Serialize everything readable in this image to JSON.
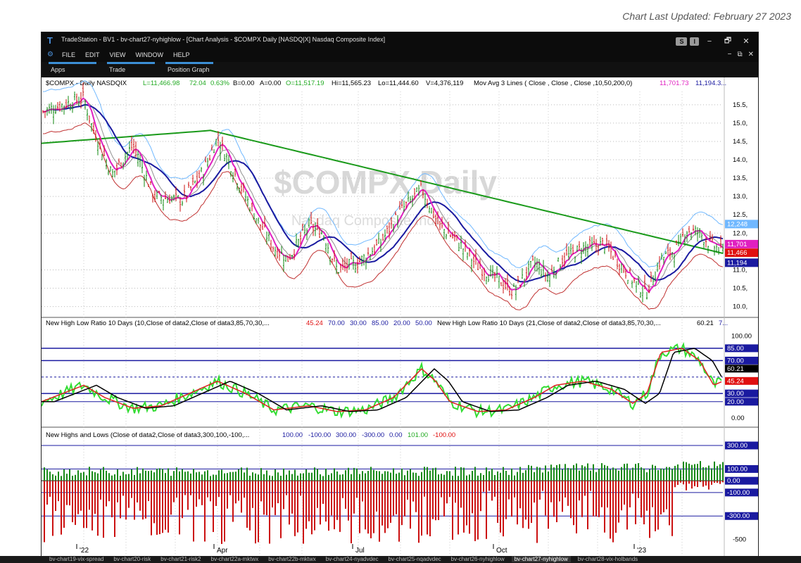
{
  "updated": "Chart Last Updated: February 27 2023",
  "window": {
    "title": "TradeStation - BV1 - bv-chart27-nyhighlow - [Chart Analysis - $COMPX Daily [NASDQ|X] Nasdaq Composite Index]",
    "ctrl_s": "S",
    "ctrl_i": "I",
    "min": "−",
    "restore": "🗗",
    "close": "✕"
  },
  "menu": {
    "file": "FILE",
    "edit": "EDIT",
    "view": "VIEW",
    "window": "WINDOW",
    "help": "HELP"
  },
  "quickbar": {
    "apps": "Apps",
    "trade": "Trade",
    "position_graph": "Position Graph"
  },
  "colors": {
    "red": "#e01010",
    "green": "#22aa22",
    "blue": "#1a1aa0",
    "magenta": "#e020c0",
    "lightblue": "#70b8ff",
    "gray": "#909090",
    "brown": "#c03030"
  },
  "panel1": {
    "symbol": "$COMPX - Daily  NASDQIX",
    "last": "L=11,466.98",
    "chg": "72.04",
    "pct": "0.63%",
    "b": "B=0.00",
    "a": "A=0.00",
    "o": "O=11,517.19",
    "hi": "Hi=11,565.23",
    "lo": "Lo=11,444.60",
    "v": "V=4,376,119",
    "ma": "Mov Avg 3 Lines ( Close , Close , Close ,10,50,200,0)",
    "ma1": "11,701.73",
    "ma2": "11,194.3...",
    "watermark": "$COMPX Daily",
    "watermark2": "Nasdaq Composite Index",
    "ticks": [
      "15.5",
      "15.0",
      "14.5",
      "14.0",
      "13.5",
      "13.0",
      "12.5",
      "12.0",
      "11.0",
      "10.5",
      "10.0"
    ],
    "flags": [
      "12,248",
      "11,701",
      "11,466",
      "11,194"
    ]
  },
  "panel2": {
    "title1": "New High Low Ratio 10 Days (10,Close of data2,Close of data3,85,70,30,...",
    "v1": "45.24",
    "v2": "70.00",
    "v3": "30.00",
    "v4": "85.00",
    "v5": "20.00",
    "v6": "50.00",
    "title2": "New High Low Ratio 10 Days (21,Close of data2,Close of data3,85,70,30,...",
    "v7": "60.21",
    "v8": "7...",
    "ticks": [
      "100.00",
      "0.00"
    ],
    "flags": [
      "85.00",
      "70.00",
      "60.21",
      "45.24",
      "30.00",
      "20.00"
    ]
  },
  "panel3": {
    "title": "New Highs and Lows (Close of data2,Close of data3,300,100,-100,...",
    "v1": "100.00",
    "v2": "-100.00",
    "v3": "300.00",
    "v4": "-300.00",
    "v5": "0.00",
    "v6": "101.00",
    "v7": "-100.00",
    "ticks": [
      "-500"
    ],
    "flags": [
      "300.00",
      "100.00",
      "0.00",
      "-100.00",
      "-300.00"
    ]
  },
  "xaxis": [
    "'22",
    "Apr",
    "Jul",
    "Oct",
    "'23"
  ],
  "tabs": [
    "bv-chart19-vix-spread",
    "bv-chart20-risk",
    "bv-chart21-risk2",
    "bv-chart22a-mktwx",
    "bv-chart22b-mktwx",
    "bv-chart24-nyadvdec",
    "bv-chart25-nqadvdec",
    "bv-chart26-nyhighlow",
    "bv-chart27-nyhighlow",
    "bv-chart28-vix-holbands"
  ],
  "chart_data": {
    "type": "line",
    "panels": [
      {
        "name": "$COMPX Daily",
        "x": [
          "'22",
          "Apr",
          "Jul",
          "Oct",
          "'23"
        ],
        "ylim": [
          9.8,
          15.9
        ],
        "series": [
          {
            "name": "$COMPX",
            "values": [
              15.6,
              13.5,
              14.8,
              11.2,
              12.0,
              13.2,
              10.9,
              11.3,
              10.6,
              12.1,
              11.47
            ]
          },
          {
            "name": "Mov Avg 200",
            "values": [
              14.5,
              14.8,
              14.8,
              14.4,
              14.0,
              13.5,
              12.8,
              12.4,
              12.0,
              11.7,
              11.47
            ]
          },
          {
            "name": "Mov Avg 50",
            "values": [
              15.3,
              14.5,
              13.9,
              13.0,
              11.5,
              11.8,
              12.0,
              11.1,
              11.0,
              11.0,
              11.19
            ]
          },
          {
            "name": "Mov Avg 10",
            "values": [
              15.4,
              13.7,
              14.5,
              11.4,
              12.0,
              13.0,
              11.0,
              11.1,
              10.5,
              11.5,
              11.7
            ]
          }
        ]
      },
      {
        "name": "New High Low Ratio 10 Days",
        "ylim": [
          0,
          100
        ],
        "series": [
          {
            "name": "10",
            "values": [
              30,
              45,
              20,
              40,
              15,
              65,
              20,
              45,
              20,
              90,
              45.24
            ]
          },
          {
            "name": "21",
            "values": [
              35,
              40,
              25,
              35,
              18,
              55,
              25,
              38,
              25,
              80,
              60.21
            ]
          }
        ]
      },
      {
        "name": "New Highs and Lows",
        "ylim": [
          -500,
          300
        ],
        "series": [
          {
            "name": "New Highs",
            "values": [
              101
            ]
          },
          {
            "name": "New Lows",
            "values": [
              -100
            ]
          }
        ]
      }
    ]
  }
}
